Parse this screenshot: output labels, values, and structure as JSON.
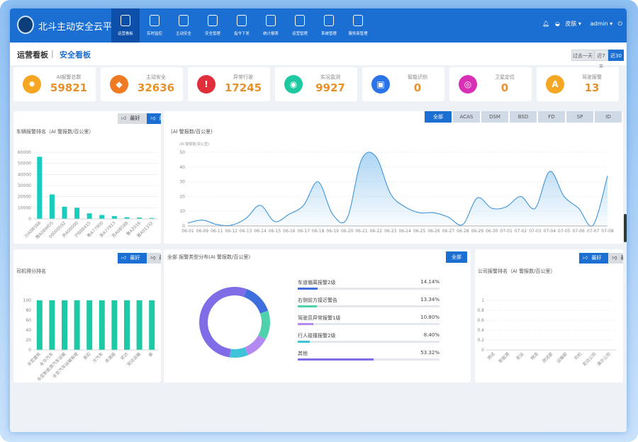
{
  "app": {
    "title": "北斗主动安全云平台"
  },
  "nav": [
    {
      "label": "运营看板",
      "icon": "shield-icon",
      "active": true
    },
    {
      "label": "实时监控",
      "icon": "location-pin-icon"
    },
    {
      "label": "主动安全",
      "icon": "shield-check-icon"
    },
    {
      "label": "安全管理",
      "icon": "shield-edit-icon"
    },
    {
      "label": "指令下发",
      "icon": "command-icon"
    },
    {
      "label": "统计报表",
      "icon": "bar-chart-icon"
    },
    {
      "label": "运营管理",
      "icon": "document-icon"
    },
    {
      "label": "系统管理",
      "icon": "monitor-icon"
    },
    {
      "label": "服务商管理",
      "icon": "sliders-icon"
    }
  ],
  "header_right": {
    "bell": "bell-icon",
    "skin": "皮肤",
    "user": "admin",
    "power": "power-icon"
  },
  "tabs": {
    "ops": "运营看板",
    "sep": "|",
    "safety": "安全看板"
  },
  "range_buttons": [
    {
      "label": "过去一天"
    },
    {
      "label": "近7天"
    },
    {
      "label": "近30天",
      "active": true
    }
  ],
  "kpis": [
    {
      "label": "AI报警总数",
      "value": "59821",
      "color": "#f5a623",
      "icon": "sun-icon",
      "glyph": "✹"
    },
    {
      "label": "主动安全",
      "value": "32636",
      "color": "#f07a22",
      "icon": "shield-icon",
      "glyph": "◆"
    },
    {
      "label": "异常行驶",
      "value": "17245",
      "color": "#e02e3b",
      "icon": "warning-icon",
      "glyph": "!"
    },
    {
      "label": "实况监测",
      "value": "9927",
      "color": "#1ec9a1",
      "icon": "eye-off-icon",
      "glyph": "◉"
    },
    {
      "label": "智能识别",
      "value": "0",
      "color": "#2b73e6",
      "icon": "car-icon",
      "glyph": "▣"
    },
    {
      "label": "卫星定位",
      "value": "0",
      "color": "#d82fb5",
      "icon": "map-pin-icon",
      "glyph": "◎"
    },
    {
      "label": "驾驶报警",
      "value": "13",
      "color": "#f5a623",
      "icon": "ai-badge-icon",
      "glyph": "A"
    }
  ],
  "good_bad": {
    "good": "最好",
    "bad": "最差"
  },
  "vehicle_rank": {
    "title": "车辆报警排名（AI 警报数/百公里）",
    "chart_data": {
      "type": "bar",
      "categories": [
        "川A0B588",
        "豫A08WD5",
        "00000592",
        "京A00000",
        "沪B80415",
        "粤A77900",
        "浙A77913",
        "苏A0B588",
        "鲁A2016",
        "晋A01332"
      ],
      "values": [
        56000,
        22000,
        11000,
        10000,
        5000,
        3500,
        2500,
        1500,
        1200,
        800
      ],
      "yticks": [
        "0",
        "10000",
        "20000",
        "30000",
        "40000",
        "50000",
        "60000"
      ],
      "ylim": [
        0,
        60000
      ]
    }
  },
  "trend": {
    "title": "(AI 警报数/百公里)",
    "unit": "(AI 警报数/百公里)",
    "toggles": [
      {
        "label": "全部",
        "active": true
      },
      {
        "label": "ACAS"
      },
      {
        "label": "DSM"
      },
      {
        "label": "BSD"
      },
      {
        "label": "FD"
      },
      {
        "label": "SP"
      },
      {
        "label": "ID"
      }
    ],
    "chart_data": {
      "type": "area",
      "x": [
        "06-01",
        "06-09",
        "06-11",
        "06-12",
        "06-13",
        "06-14",
        "06-15",
        "06-16",
        "06-17",
        "06-18",
        "06-19",
        "06-20",
        "06-21",
        "06-22",
        "06-23",
        "06-24",
        "06-25",
        "06-26",
        "06-27",
        "06-28",
        "06-29",
        "06-30",
        "07-01",
        "07-02",
        "07-03",
        "07-04",
        "07-05",
        "07-06",
        "07-07",
        "07-08"
      ],
      "values": [
        2,
        4,
        1,
        0.5,
        5,
        14,
        3,
        8,
        14,
        30,
        8,
        5,
        45,
        47,
        22,
        13,
        9,
        9,
        6,
        1,
        19,
        12,
        13,
        20,
        12,
        37,
        20,
        12,
        0.5,
        34
      ],
      "yticks": [
        "0",
        "10",
        "20",
        "30",
        "40",
        "50"
      ],
      "ylim": [
        0,
        50
      ]
    }
  },
  "driver_rank": {
    "title": "司机得分排名",
    "chart_data": {
      "type": "bar",
      "categories": [
        "永宏建筑",
        "永华汽车",
        "永宏新能源汽车运输",
        "永宏汽车运输有限",
        "滚石",
        "冷汽车",
        "赤湖县",
        "宏达",
        "安达运输",
        "泰"
      ],
      "values": [
        100,
        100,
        100,
        100,
        100,
        100,
        100,
        100,
        100,
        100
      ],
      "yticks": [
        "0",
        "20",
        "40",
        "60",
        "80",
        "100"
      ],
      "ylim": [
        0,
        100
      ]
    }
  },
  "distribution": {
    "title": "全部 报警类型分布(AI 警报数/百公里)",
    "button": "全部",
    "chart_data": {
      "type": "pie",
      "items": [
        {
          "name": "车道偏离报警2级",
          "percent": "14.14%",
          "value": 14.14,
          "color": "#3f6fdd"
        },
        {
          "name": "右侧前方接近警告",
          "percent": "13.34%",
          "value": 13.34,
          "color": "#4fd1ac"
        },
        {
          "name": "驾驶员异常报警1级",
          "percent": "10.80%",
          "value": 10.8,
          "color": "#b38af0"
        },
        {
          "name": "行人碰撞报警2级",
          "percent": "8.40%",
          "value": 8.4,
          "color": "#3fc3d8"
        },
        {
          "name": "其他",
          "percent": "53.32%",
          "value": 53.32,
          "color": "#7f6de8"
        }
      ]
    }
  },
  "company_rank": {
    "title": "公司报警排名（AI 警报数/百公里）",
    "chart_data": {
      "type": "bar",
      "categories": [
        "测试",
        "新能源",
        "宏运",
        "物流",
        "测试部",
        "运输部",
        "司机",
        "宏达公司",
        "演示公司"
      ],
      "values": [
        0,
        0,
        0,
        0,
        0,
        0,
        0,
        0,
        0
      ],
      "yticks": [
        "0",
        "0.2",
        "0.4",
        "0.6",
        "0.8",
        "1"
      ],
      "ylim": [
        0,
        1
      ]
    }
  }
}
